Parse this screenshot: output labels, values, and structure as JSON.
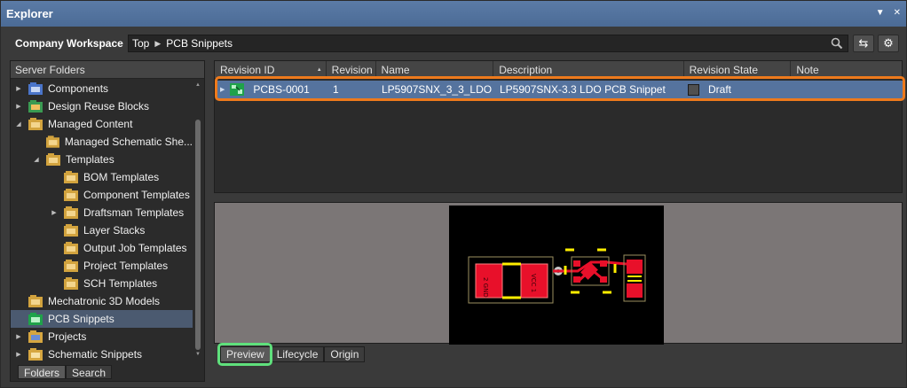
{
  "window": {
    "title": "Explorer",
    "controls": [
      "pin-down-icon",
      "close-icon"
    ]
  },
  "toolbar": {
    "workspace": "Company Workspace",
    "breadcrumb": [
      "Top",
      "PCB Snippets"
    ]
  },
  "left_panel": {
    "header": "Server Folders",
    "tree": [
      {
        "label": "Components",
        "level": 0,
        "expander": "collapsed"
      },
      {
        "label": "Design Reuse Blocks",
        "level": 0,
        "expander": "collapsed"
      },
      {
        "label": "Managed Content",
        "level": 0,
        "expander": "expanded"
      },
      {
        "label": "Managed Schematic She...",
        "level": 1,
        "expander": "none"
      },
      {
        "label": "Templates",
        "level": 1,
        "expander": "expanded"
      },
      {
        "label": "BOM Templates",
        "level": 2,
        "expander": "none"
      },
      {
        "label": "Component Templates",
        "level": 2,
        "expander": "none"
      },
      {
        "label": "Draftsman Templates",
        "level": 2,
        "expander": "collapsed"
      },
      {
        "label": "Layer Stacks",
        "level": 2,
        "expander": "none"
      },
      {
        "label": "Output Job Templates",
        "level": 2,
        "expander": "none"
      },
      {
        "label": "Project Templates",
        "level": 2,
        "expander": "none"
      },
      {
        "label": "SCH Templates",
        "level": 2,
        "expander": "none"
      },
      {
        "label": "Mechatronic 3D Models",
        "level": 0,
        "expander": "none"
      },
      {
        "label": "PCB Snippets",
        "level": 0,
        "expander": "none",
        "selected": true
      },
      {
        "label": "Projects",
        "level": 0,
        "expander": "collapsed"
      },
      {
        "label": "Schematic Snippets",
        "level": 0,
        "expander": "collapsed"
      }
    ],
    "tabs": [
      "Folders",
      "Search"
    ]
  },
  "table": {
    "columns": [
      "Revision ID",
      "Revision",
      "Name",
      "Description",
      "Revision State",
      "Note"
    ],
    "row": {
      "revision_id": "PCBS-0001",
      "revision": "1",
      "name": "LP5907SNX_3_3_LDO",
      "description": "LP5907SNX-3.3 LDO PCB Snippet",
      "state": "Draft",
      "note": ""
    }
  },
  "preview": {
    "tabs": [
      "Preview",
      "Lifecycle",
      "Origin"
    ],
    "pcb_labels": {
      "left_pad": "2 GND",
      "right_pad": "VCC 1"
    }
  },
  "colors": {
    "title_bar": "#4f6f9a",
    "selected_row": "#55739e",
    "row_highlight": "#ee7a1c",
    "tab_highlight": "#5fe07c",
    "pcb_copper": "#e8102a",
    "pcb_silk": "#ffee00"
  }
}
